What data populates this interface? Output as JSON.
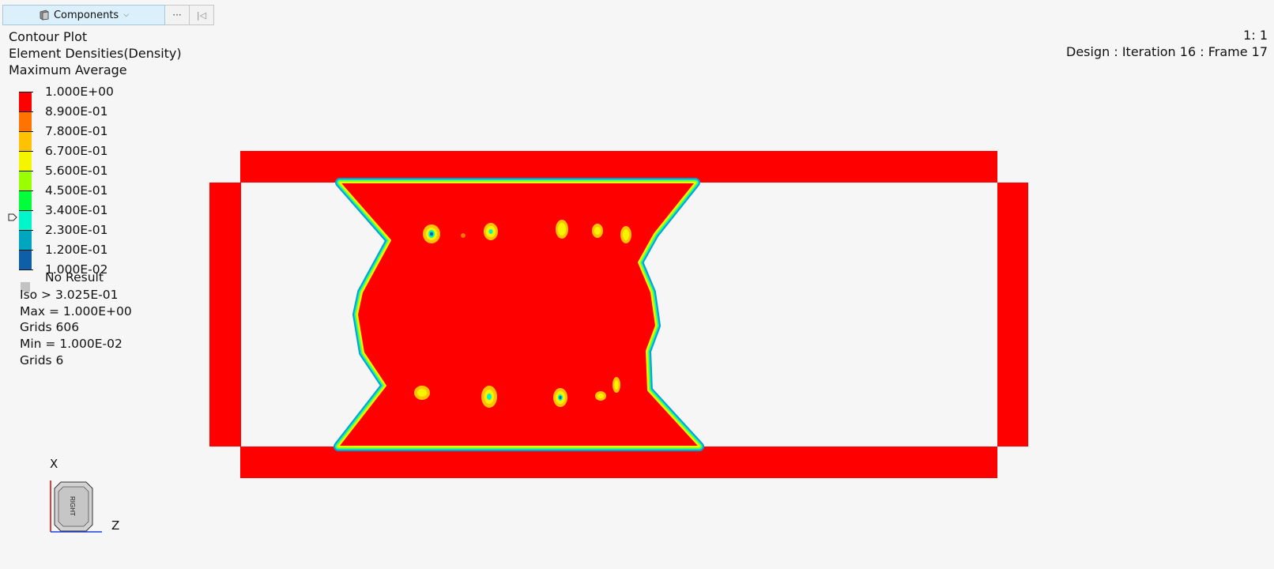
{
  "toolbar": {
    "components_label": "Components",
    "more_label": "···",
    "first_label": "|◁"
  },
  "legend": {
    "plot_type": "Contour Plot",
    "result_type": "Element Densities(Density)",
    "averaging": "Maximum Average",
    "levels": [
      "1.000E+00",
      "8.900E-01",
      "7.800E-01",
      "6.700E-01",
      "5.600E-01",
      "4.500E-01",
      "3.400E-01",
      "2.300E-01",
      "1.200E-01",
      "1.000E-02"
    ],
    "colors": [
      "#ff0000",
      "#ff7300",
      "#ffc200",
      "#f5f500",
      "#9aff00",
      "#00ff3a",
      "#00f5c8",
      "#00a6bd",
      "#0f5fa8",
      "#07207c"
    ],
    "no_result": "No Result",
    "no_result_color": "#c3c3c3",
    "iso": "Iso > 3.025E-01",
    "max": "Max =  1.000E+00",
    "max_grids": "Grids 606",
    "min": "Min =  1.000E-02",
    "min_grids": "Grids 6"
  },
  "view": {
    "scale": "1: 1",
    "design": "Design : Iteration 16 : Frame 17"
  },
  "triad": {
    "x_label": "X",
    "z_label": "Z",
    "cube_face": "RIGHT"
  }
}
